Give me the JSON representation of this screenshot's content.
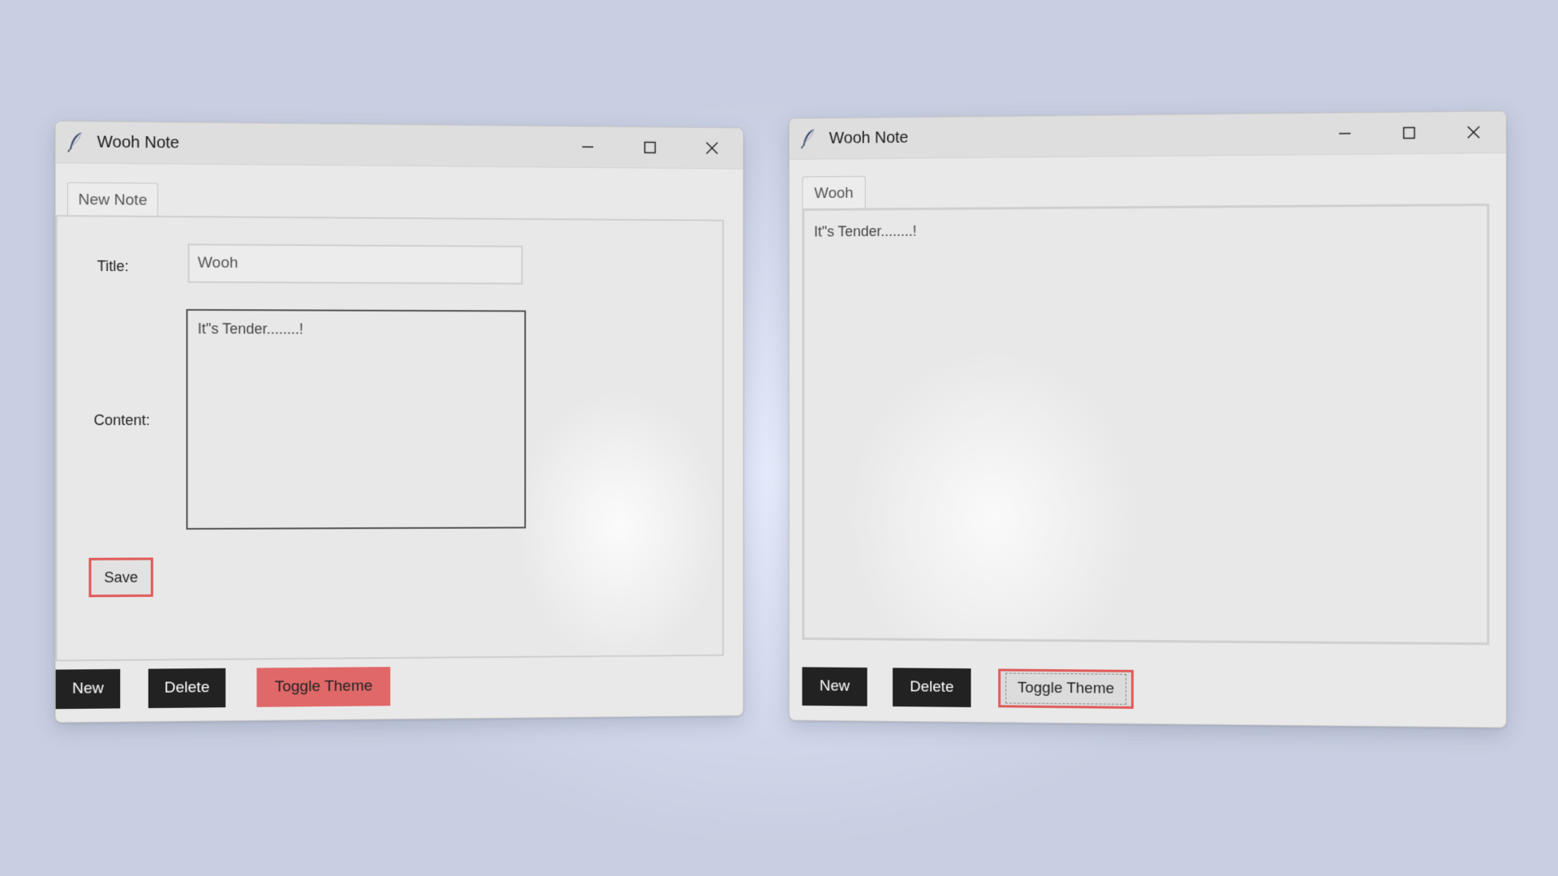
{
  "windows": [
    {
      "title": "Wooh Note",
      "tab_label": "New Note",
      "title_label": "Title:",
      "title_value": "Wooh",
      "content_label": "Content:",
      "content_value": "It\"s Tender........!",
      "save_label": "Save",
      "new_label": "New",
      "delete_label": "Delete",
      "toggle_label": "Toggle Theme"
    },
    {
      "title": "Wooh Note",
      "tab_label": "Wooh",
      "content_value": "It\"s Tender........!",
      "new_label": "New",
      "delete_label": "Delete",
      "toggle_label": "Toggle Theme"
    }
  ],
  "colors": {
    "accent_red": "#e06868",
    "dark_button": "#222222",
    "desktop": "#d5dbee"
  },
  "icons": {
    "app": "feather-icon",
    "minimize": "minimize-icon",
    "maximize": "maximize-icon",
    "close": "close-icon"
  }
}
